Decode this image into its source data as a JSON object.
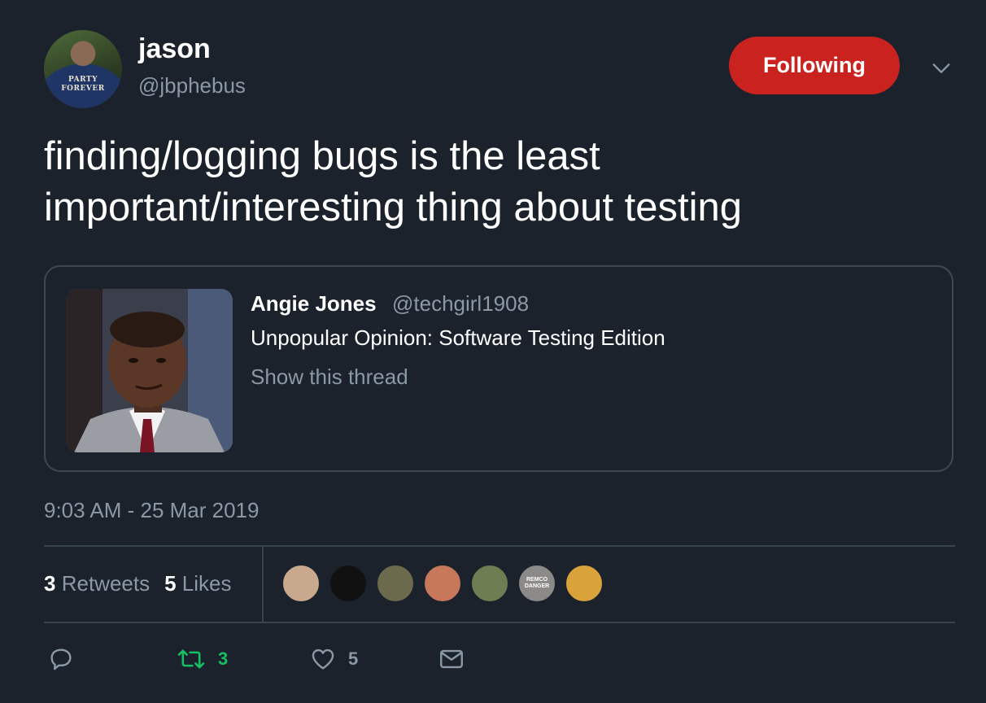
{
  "author": {
    "display_name": "jason",
    "handle": "@jbphebus",
    "avatar_shirt_text": "PARTY\nFOREVER"
  },
  "follow_button": {
    "label": "Following",
    "color": "#c9221f"
  },
  "tweet": {
    "text": "finding/logging bugs is the least\nimportant/interesting thing about testing",
    "timestamp": "9:03 AM - 25 Mar 2019"
  },
  "quoted_tweet": {
    "name": "Angie Jones",
    "handle": "@techgirl1908",
    "text": "Unpopular Opinion: Software Testing Edition",
    "thread_link": "Show this thread"
  },
  "stats": {
    "retweets_count": "3",
    "retweets_label": "Retweets",
    "likes_count": "5",
    "likes_label": "Likes"
  },
  "likers": [
    {
      "name": "liker-1-avatar",
      "color": "#c8a98d"
    },
    {
      "name": "liker-2-avatar",
      "color": "#111111"
    },
    {
      "name": "liker-3-avatar",
      "color": "#6b6a4c"
    },
    {
      "name": "liker-4-avatar",
      "color": "#c7775a"
    },
    {
      "name": "liker-5-avatar",
      "color": "#6e7d52"
    },
    {
      "name": "liker-6-avatar",
      "color": "#8c8a88",
      "text": "REMCO\nDANGER"
    },
    {
      "name": "liker-7-avatar",
      "color": "#d9a23a"
    }
  ],
  "actions": {
    "reply_icon": "reply-icon",
    "retweet_icon": "retweet-icon",
    "retweet_count": "3",
    "retweet_color": "#17bf63",
    "like_icon": "heart-icon",
    "like_count": "5",
    "dm_icon": "envelope-icon"
  },
  "colors": {
    "background": "#1b222c",
    "secondary_text": "#8b98a5",
    "border": "#38444d"
  }
}
